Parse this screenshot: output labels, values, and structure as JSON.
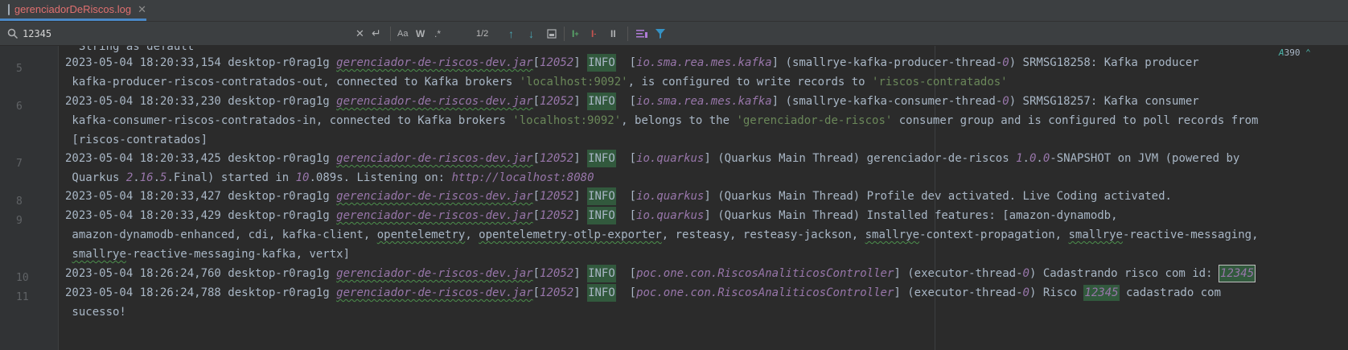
{
  "tab": {
    "label": "gerenciadorDeRiscos.log",
    "close": "✕"
  },
  "find": {
    "query": "12345",
    "match_count": "1/2",
    "options": {
      "match_case": "Aa",
      "words": "W",
      "regex": ".*"
    }
  },
  "inspection": {
    "count": "390"
  },
  "gutter": [
    "5",
    "6",
    "7",
    "8",
    "9",
    "10",
    "11"
  ],
  "lines": {
    "l0": "  String as default",
    "l1_date": "2023-05-04 18:20:33,154",
    "l1_host": " desktop-r0rag1g ",
    "l1_jar": "gerenciador-de-riscos-dev.jar",
    "l1_pid": "12052",
    "l1_lvl": "INFO",
    "l1_cat": "io.sma.rea.mes.kafka",
    "l1_thr_a": "smallrye-kafka-producer-thread-",
    "l1_thr_n": "0",
    "l1_msg": "SRMSG18258: Kafka producer",
    "l2_a": " kafka-producer-riscos-contratados-out, connected to Kafka brokers ",
    "l2_s1": "'localhost:9092'",
    "l2_b": ", is configured to write records to ",
    "l2_s2": "'riscos-contratados'",
    "l3_date": "2023-05-04 18:20:33,230",
    "l3_host": " desktop-r0rag1g ",
    "l3_jar": "gerenciador-de-riscos-dev.jar",
    "l3_pid": "12052",
    "l3_lvl": "INFO",
    "l3_cat": "io.sma.rea.mes.kafka",
    "l3_thr_a": "smallrye-kafka-consumer-thread-",
    "l3_thr_n": "0",
    "l3_msg": "SRMSG18257: Kafka consumer",
    "l4_a": " kafka-consumer-riscos-contratados-in, connected to Kafka brokers ",
    "l4_s1": "'localhost:9092'",
    "l4_b": ", belongs to the ",
    "l4_s2": "'gerenciador-de-riscos'",
    "l4_c": " consumer group and is configured to poll records from",
    "l5": " [riscos-contratados]",
    "l6_date": "2023-05-04 18:20:33,425",
    "l6_host": " desktop-r0rag1g ",
    "l6_jar": "gerenciador-de-riscos-dev.jar",
    "l6_pid": "12052",
    "l6_lvl": "INFO",
    "l6_cat": "io.quarkus",
    "l6_msg_a": "(Quarkus Main Thread) gerenciador-de-riscos ",
    "l6_v1": "1",
    "l6_d1": ".",
    "l6_v2": "0",
    "l6_d2": ".",
    "l6_v3": "0",
    "l6_msg_b": "-SNAPSHOT on JVM (powered by",
    "l7_a": " Quarkus ",
    "l7_n1": "2",
    "l7_b": ".",
    "l7_n2": "16",
    "l7_c": ".",
    "l7_n3": "5",
    "l7_d": ".Final) started in ",
    "l7_n4": "10",
    "l7_e": ".089s. Listening on: ",
    "l7_url": "http://localhost:8080",
    "l8_date": "2023-05-04 18:20:33,427",
    "l8_host": " desktop-r0rag1g ",
    "l8_jar": "gerenciador-de-riscos-dev.jar",
    "l8_pid": "12052",
    "l8_lvl": "INFO",
    "l8_cat": "io.quarkus",
    "l8_msg": "(Quarkus Main Thread) Profile dev activated. Live Coding activated.",
    "l9_date": "2023-05-04 18:20:33,429",
    "l9_host": " desktop-r0rag1g ",
    "l9_jar": "gerenciador-de-riscos-dev.jar",
    "l9_pid": "12052",
    "l9_lvl": "INFO",
    "l9_cat": "io.quarkus",
    "l9_msg": "(Quarkus Main Thread) Installed features: [amazon-dynamodb,",
    "l10_a": " amazon-dynamodb-enhanced, cdi, kafka-client, ",
    "l10_u1": "opentelemetry",
    "l10_b": ", ",
    "l10_u2": "opentelemetry-otlp-exporter",
    "l10_c": ", resteasy, resteasy-jackson, ",
    "l10_u3": "smallrye",
    "l10_d": "-context-propagation, ",
    "l10_u4": "smallrye",
    "l10_e": "-reactive-messaging,",
    "l11_u": "smallrye",
    "l11_rest": "-reactive-messaging-kafka, vertx]",
    "l12_date": "2023-05-04 18:26:24,760",
    "l12_host": " desktop-r0rag1g ",
    "l12_jar": "gerenciador-de-riscos-dev.jar",
    "l12_pid": "12052",
    "l12_lvl": "INFO",
    "l12_cat": "poc.one.con.RiscosAnaliticosController",
    "l12_thr": "(executor-thread-",
    "l12_thr_n": "0",
    "l12_msg": ") Cadastrando risco com id: ",
    "l12_hit": "12345",
    "l13_date": "2023-05-04 18:26:24,788",
    "l13_host": " desktop-r0rag1g ",
    "l13_jar": "gerenciador-de-riscos-dev.jar",
    "l13_pid": "12052",
    "l13_lvl": "INFO",
    "l13_cat": "poc.one.con.RiscosAnaliticosController",
    "l13_thr": "(executor-thread-",
    "l13_thr_n": "0",
    "l13_msg_a": ") Risco ",
    "l13_hit": "12345",
    "l13_msg_b": " cadastrado com",
    "l14": " sucesso!"
  }
}
